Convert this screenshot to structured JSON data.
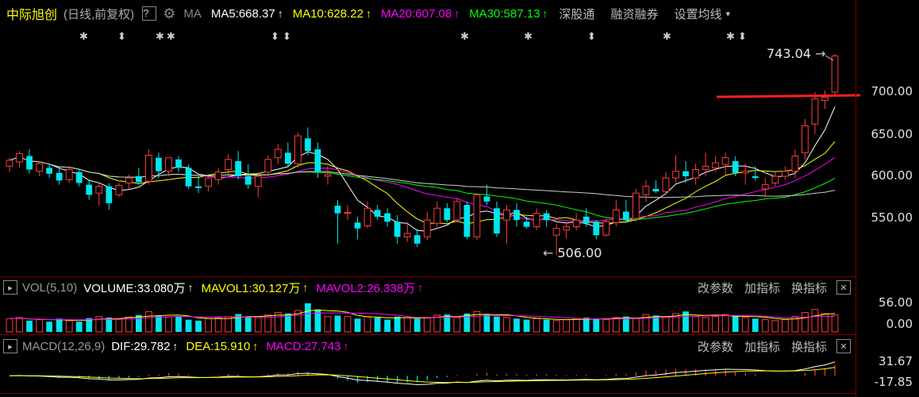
{
  "header": {
    "stock_name": "中际旭创",
    "period_label": "(日线,前复权)",
    "help_icon_label": "?",
    "ma_label": "MA",
    "ma5": "MA5:668.37",
    "ma10": "MA10:628.22",
    "ma20": "MA20:607.08",
    "ma30": "MA30:587.13",
    "arrow": "↑",
    "exchange_link": "深股通",
    "margin_link": "融资融券",
    "settings_link": "设置均线",
    "dropdown_glyph": "▾",
    "colors": {
      "ma5": "#ffffff",
      "ma10": "#ffff00",
      "ma20": "#ff00ff",
      "ma30": "#00ff00",
      "stock_name": "#ffff00"
    }
  },
  "price_panel": {
    "y_labels": [
      "700.00",
      "650.00",
      "600.00",
      "550.00"
    ],
    "high_marker": "743.04",
    "low_marker": "506.00",
    "star_glyph": "✱",
    "diamond_glyph": "⬍"
  },
  "vol_panel": {
    "title": "VOL(5,10)",
    "volume": "VOLUME:33.080万",
    "mavol1": "MAVOL1:30.127万",
    "mavol2": "MAVOL2:26.338万",
    "arrow": "↑",
    "params_btn": "改参数",
    "add_indicator_btn": "加指标",
    "switch_indicator_btn": "换指标",
    "close_glyph": "✕",
    "y_labels": [
      "56.00",
      "0.00"
    ],
    "colors": {
      "volume": "#ffffff",
      "mavol1": "#ffff00",
      "mavol2": "#ff00ff"
    }
  },
  "macd_panel": {
    "title": "MACD(12,26,9)",
    "dif": "DIF:29.782",
    "dea": "DEA:15.910",
    "macd": "MACD:27.743",
    "arrow": "↑",
    "params_btn": "改参数",
    "add_indicator_btn": "加指标",
    "switch_indicator_btn": "换指标",
    "close_glyph": "✕",
    "y_labels": [
      "31.67",
      "-17.85"
    ],
    "colors": {
      "dif": "#ffffff",
      "dea": "#ffff00",
      "macd": "#ff00ff"
    }
  },
  "chart_data": {
    "type": "candlestick",
    "ylim": [
      506,
      743.04
    ],
    "candles": [
      {
        "o": 612,
        "h": 622,
        "l": 605,
        "c": 619
      },
      {
        "o": 617,
        "h": 630,
        "l": 610,
        "c": 627
      },
      {
        "o": 624,
        "h": 632,
        "l": 603,
        "c": 608
      },
      {
        "o": 606,
        "h": 618,
        "l": 600,
        "c": 615
      },
      {
        "o": 610,
        "h": 614,
        "l": 598,
        "c": 603
      },
      {
        "o": 604,
        "h": 610,
        "l": 590,
        "c": 595
      },
      {
        "o": 596,
        "h": 612,
        "l": 592,
        "c": 608
      },
      {
        "o": 605,
        "h": 608,
        "l": 588,
        "c": 592
      },
      {
        "o": 590,
        "h": 596,
        "l": 572,
        "c": 578
      },
      {
        "o": 580,
        "h": 592,
        "l": 565,
        "c": 588
      },
      {
        "o": 588,
        "h": 592,
        "l": 560,
        "c": 568
      },
      {
        "o": 578,
        "h": 592,
        "l": 575,
        "c": 589
      },
      {
        "o": 592,
        "h": 602,
        "l": 585,
        "c": 598
      },
      {
        "o": 600,
        "h": 610,
        "l": 590,
        "c": 593
      },
      {
        "o": 594,
        "h": 632,
        "l": 590,
        "c": 625
      },
      {
        "o": 622,
        "h": 628,
        "l": 598,
        "c": 606
      },
      {
        "o": 606,
        "h": 612,
        "l": 600,
        "c": 622
      },
      {
        "o": 620,
        "h": 624,
        "l": 605,
        "c": 610
      },
      {
        "o": 610,
        "h": 614,
        "l": 585,
        "c": 588
      },
      {
        "o": 588,
        "h": 600,
        "l": 580,
        "c": 586
      },
      {
        "o": 588,
        "h": 600,
        "l": 582,
        "c": 598
      },
      {
        "o": 596,
        "h": 610,
        "l": 590,
        "c": 605
      },
      {
        "o": 608,
        "h": 626,
        "l": 600,
        "c": 620
      },
      {
        "o": 618,
        "h": 630,
        "l": 596,
        "c": 600
      },
      {
        "o": 600,
        "h": 614,
        "l": 585,
        "c": 590
      },
      {
        "o": 588,
        "h": 605,
        "l": 575,
        "c": 600
      },
      {
        "o": 605,
        "h": 625,
        "l": 600,
        "c": 620
      },
      {
        "o": 622,
        "h": 638,
        "l": 615,
        "c": 632
      },
      {
        "o": 628,
        "h": 640,
        "l": 610,
        "c": 615
      },
      {
        "o": 615,
        "h": 652,
        "l": 610,
        "c": 648
      },
      {
        "o": 645,
        "h": 658,
        "l": 625,
        "c": 630
      },
      {
        "o": 632,
        "h": 640,
        "l": 598,
        "c": 605
      },
      {
        "o": 600,
        "h": 612,
        "l": 590,
        "c": 602
      },
      {
        "o": 565,
        "h": 572,
        "l": 520,
        "c": 556
      },
      {
        "o": 556,
        "h": 566,
        "l": 548,
        "c": 557
      },
      {
        "o": 545,
        "h": 552,
        "l": 525,
        "c": 538
      },
      {
        "o": 541,
        "h": 570,
        "l": 538,
        "c": 562
      },
      {
        "o": 560,
        "h": 566,
        "l": 548,
        "c": 552
      },
      {
        "o": 556,
        "h": 562,
        "l": 540,
        "c": 546
      },
      {
        "o": 546,
        "h": 554,
        "l": 520,
        "c": 528
      },
      {
        "o": 528,
        "h": 546,
        "l": 522,
        "c": 532
      },
      {
        "o": 530,
        "h": 538,
        "l": 516,
        "c": 520
      },
      {
        "o": 528,
        "h": 558,
        "l": 524,
        "c": 548
      },
      {
        "o": 544,
        "h": 570,
        "l": 538,
        "c": 562
      },
      {
        "o": 562,
        "h": 568,
        "l": 545,
        "c": 548
      },
      {
        "o": 548,
        "h": 574,
        "l": 545,
        "c": 570
      },
      {
        "o": 566,
        "h": 570,
        "l": 525,
        "c": 528
      },
      {
        "o": 528,
        "h": 580,
        "l": 524,
        "c": 578
      },
      {
        "o": 576,
        "h": 590,
        "l": 566,
        "c": 570
      },
      {
        "o": 562,
        "h": 570,
        "l": 528,
        "c": 532
      },
      {
        "o": 548,
        "h": 566,
        "l": 520,
        "c": 560
      },
      {
        "o": 560,
        "h": 568,
        "l": 540,
        "c": 548
      },
      {
        "o": 546,
        "h": 552,
        "l": 538,
        "c": 540
      },
      {
        "o": 540,
        "h": 562,
        "l": 536,
        "c": 556
      },
      {
        "o": 556,
        "h": 560,
        "l": 540,
        "c": 548
      },
      {
        "o": 530,
        "h": 544,
        "l": 506,
        "c": 538
      },
      {
        "o": 536,
        "h": 546,
        "l": 526,
        "c": 540
      },
      {
        "o": 540,
        "h": 556,
        "l": 536,
        "c": 548
      },
      {
        "o": 552,
        "h": 562,
        "l": 540,
        "c": 544
      },
      {
        "o": 546,
        "h": 548,
        "l": 525,
        "c": 530
      },
      {
        "o": 530,
        "h": 550,
        "l": 528,
        "c": 546
      },
      {
        "o": 545,
        "h": 572,
        "l": 540,
        "c": 560
      },
      {
        "o": 558,
        "h": 572,
        "l": 545,
        "c": 548
      },
      {
        "o": 550,
        "h": 585,
        "l": 546,
        "c": 580
      },
      {
        "o": 578,
        "h": 595,
        "l": 570,
        "c": 588
      },
      {
        "o": 585,
        "h": 595,
        "l": 580,
        "c": 582
      },
      {
        "o": 582,
        "h": 605,
        "l": 578,
        "c": 598
      },
      {
        "o": 598,
        "h": 625,
        "l": 592,
        "c": 606
      },
      {
        "o": 606,
        "h": 618,
        "l": 592,
        "c": 600
      },
      {
        "o": 598,
        "h": 615,
        "l": 590,
        "c": 608
      },
      {
        "o": 608,
        "h": 628,
        "l": 600,
        "c": 612
      },
      {
        "o": 610,
        "h": 624,
        "l": 605,
        "c": 616
      },
      {
        "o": 614,
        "h": 628,
        "l": 600,
        "c": 622
      },
      {
        "o": 618,
        "h": 624,
        "l": 600,
        "c": 604
      },
      {
        "o": 604,
        "h": 615,
        "l": 590,
        "c": 606
      },
      {
        "o": 600,
        "h": 612,
        "l": 595,
        "c": 598
      },
      {
        "o": 585,
        "h": 598,
        "l": 575,
        "c": 590
      },
      {
        "o": 592,
        "h": 605,
        "l": 588,
        "c": 600
      },
      {
        "o": 600,
        "h": 612,
        "l": 596,
        "c": 606
      },
      {
        "o": 606,
        "h": 632,
        "l": 598,
        "c": 624
      },
      {
        "o": 628,
        "h": 668,
        "l": 620,
        "c": 660
      },
      {
        "o": 662,
        "h": 700,
        "l": 650,
        "c": 692
      },
      {
        "o": 690,
        "h": 702,
        "l": 680,
        "c": 694
      },
      {
        "o": 700,
        "h": 745,
        "l": 695,
        "c": 743
      }
    ],
    "volumes_wan": [
      26,
      28,
      22,
      24,
      20,
      26,
      22,
      20,
      27,
      30,
      28,
      25,
      29,
      33,
      40,
      32,
      29,
      31,
      24,
      22,
      26,
      28,
      30,
      35,
      30,
      28,
      33,
      38,
      36,
      42,
      56,
      44,
      30,
      32,
      30,
      26,
      30,
      28,
      24,
      30,
      28,
      26,
      28,
      33,
      34,
      28,
      36,
      40,
      34,
      30,
      28,
      26,
      24,
      26,
      24,
      22,
      24,
      26,
      28,
      26,
      24,
      28,
      30,
      26,
      34,
      32,
      28,
      36,
      40,
      30,
      28,
      30,
      34,
      32,
      28,
      26,
      24,
      22,
      24,
      30,
      38,
      44,
      36,
      33
    ]
  }
}
